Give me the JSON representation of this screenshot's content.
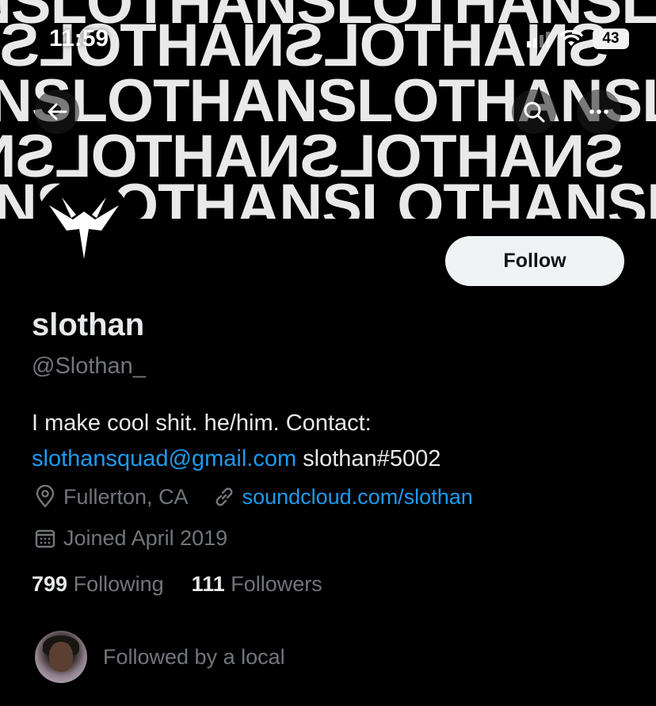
{
  "status_bar": {
    "time": "11:59",
    "battery": "43"
  },
  "banner": {
    "words": [
      "NSLOTHANSLOTHANSLOTHANS",
      "SNAHTOLSNAHTOLSNAHTOLSN",
      "NSLOTHANSLOTHANSLOTHANS",
      "SNAHTOLSNAHTOLSNAHTOLSN",
      "NSLOTHANSLOTHANSLOTHANS"
    ]
  },
  "nav": {
    "back_icon": "arrow-left-icon",
    "search_icon": "search-icon",
    "more_icon": "more-horizontal-icon"
  },
  "profile": {
    "follow_label": "Follow",
    "display_name": "slothan",
    "handle": "@Slothan_",
    "bio_text": "I make cool shit. he/him. Contact:",
    "bio_email": "slothansquad@gmail.com",
    "bio_discord": "slothan#5002",
    "location": "Fullerton, CA",
    "website": "soundcloud.com/slothan",
    "joined": "Joined April 2019",
    "following_count": "799",
    "following_label": "Following",
    "followers_count": "111",
    "followers_label": "Followers",
    "followed_by": "Followed by a local"
  },
  "colors": {
    "background": "#000000",
    "text_primary": "#e7e9ea",
    "text_secondary": "#71767b",
    "link": "#1d9bf0",
    "follow_button_bg": "#eff3f4"
  }
}
